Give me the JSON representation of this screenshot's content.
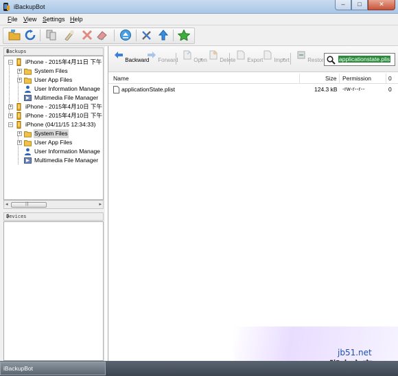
{
  "window": {
    "title": "iBackupBot",
    "buttons": [
      "‒",
      "□",
      "✕"
    ]
  },
  "menu": [
    {
      "key": "F",
      "rest": "ile"
    },
    {
      "key": "V",
      "rest": "iew"
    },
    {
      "key": "S",
      "rest": "ettings"
    },
    {
      "key": "H",
      "rest": "elp"
    }
  ],
  "backups_panel": {
    "header": "Backups",
    "pin": "‡"
  },
  "devices_panel": {
    "header": "Devices",
    "pin": "‡"
  },
  "tree": [
    {
      "label": "iPhone - 2015年4月11日 下午",
      "level": 0,
      "expander": "–",
      "icon": "phone-icon"
    },
    {
      "label": "System Files",
      "level": 1,
      "expander": "+",
      "icon": "folder-icon"
    },
    {
      "label": "User App Files",
      "level": 1,
      "expander": "+",
      "icon": "folder-icon"
    },
    {
      "label": "User Information Manage",
      "level": 1,
      "expander": "",
      "icon": "user-icon"
    },
    {
      "label": "Multimedia File Manager",
      "level": 1,
      "expander": "",
      "icon": "media-icon"
    },
    {
      "label": "iPhone - 2015年4月10日 下午",
      "level": 0,
      "expander": "+",
      "icon": "phone-icon"
    },
    {
      "label": "iPhone - 2015年4月10日 下午",
      "level": 0,
      "expander": "+",
      "icon": "phone-icon"
    },
    {
      "label": "iPhone (04/11/15 12:34:33)",
      "level": 0,
      "expander": "–",
      "icon": "phone-icon"
    },
    {
      "label": "System Files",
      "level": 1,
      "expander": "+",
      "icon": "folder-icon",
      "selected": true
    },
    {
      "label": "User App Files",
      "level": 1,
      "expander": "+",
      "icon": "folder-icon"
    },
    {
      "label": "User Information Manage",
      "level": 1,
      "expander": "",
      "icon": "user-icon"
    },
    {
      "label": "Multimedia File Manager",
      "level": 1,
      "expander": "",
      "icon": "media-icon"
    }
  ],
  "scroll": {
    "left": "◂",
    "right": "▸",
    "grip": "|||"
  },
  "nav": {
    "backward": "Backward",
    "forward": "Forward",
    "open": "Open",
    "delete": "Delete",
    "export": "Export",
    "import": "Import",
    "restore": "Restore",
    "dropdown": "▾"
  },
  "search": {
    "value": "applicationstate.plis"
  },
  "table": {
    "headers": {
      "name": "Name",
      "size": "Size",
      "permission": "Permission",
      "extra": "0"
    },
    "rows": [
      {
        "name": "applicationState.plist",
        "size": "124.3 kB",
        "permission": "-rw-r--r--",
        "extra": "0"
      }
    ]
  },
  "watermark": {
    "url": "jb51.net",
    "text": "脚本之家"
  },
  "taskbar": {
    "item": "iBackupBot"
  },
  "colors": {
    "search_highlight": "#2a8a3c",
    "title_bar": "#b9d1ea"
  }
}
